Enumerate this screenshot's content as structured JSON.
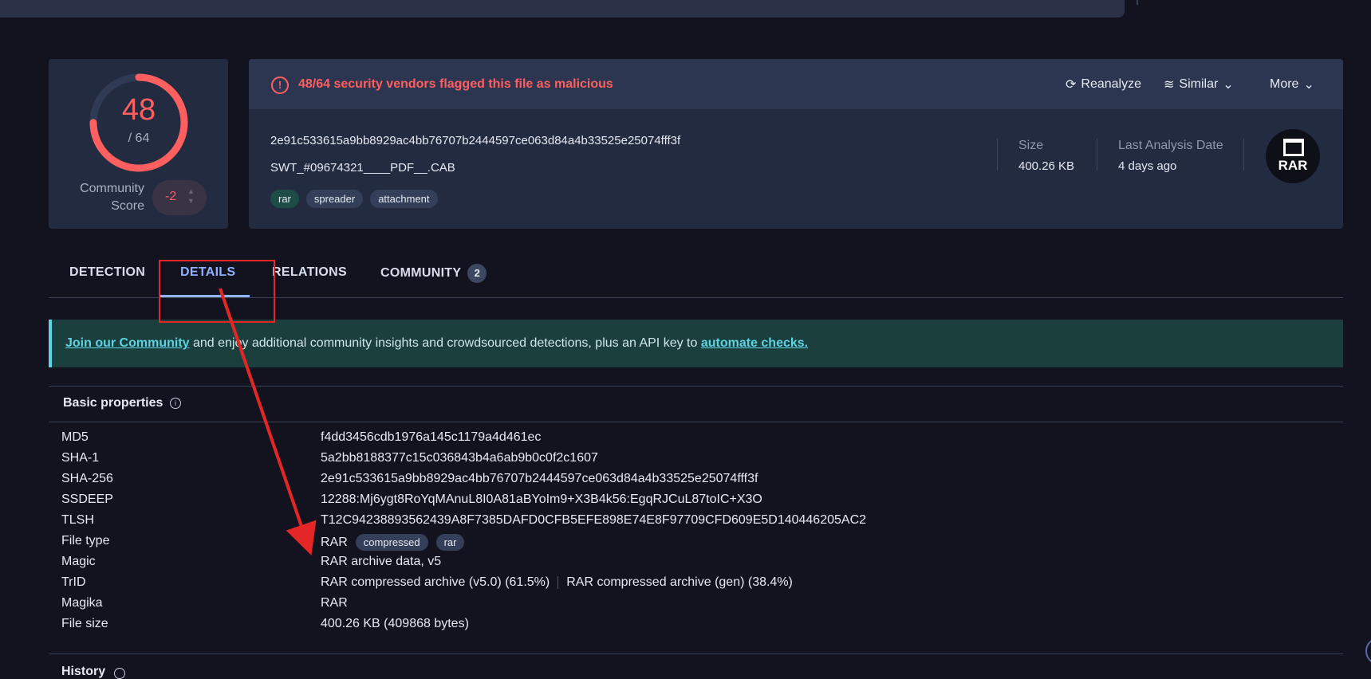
{
  "score": {
    "detections": "48",
    "total": "/ 64",
    "community_label": "Community Score",
    "community_value": "-2"
  },
  "header": {
    "alert": "48/64 security vendors flagged this file as malicious",
    "reanalyze": "Reanalyze",
    "similar": "Similar",
    "more": "More"
  },
  "file": {
    "hash": "2e91c533615a9bb8929ac4bb76707b2444597ce063d84a4b33525e25074fff3f",
    "name": "SWT_#09674321____PDF__.CAB",
    "tags": [
      "rar",
      "spreader",
      "attachment"
    ],
    "size_label": "Size",
    "size_value": "400.26 KB",
    "date_label": "Last Analysis Date",
    "date_value": "4 days ago",
    "type_badge": "RAR"
  },
  "tabs": {
    "detection": "DETECTION",
    "details": "DETAILS",
    "relations": "RELATIONS",
    "community": "COMMUNITY",
    "community_count": "2"
  },
  "banner": {
    "link1": "Join our Community",
    "text": " and enjoy additional community insights and crowdsourced detections, plus an API key to ",
    "link2": "automate checks."
  },
  "basic": {
    "title": "Basic properties",
    "md5_key": "MD5",
    "md5": "f4dd3456cdb1976a145c1179a4d461ec",
    "sha1_key": "SHA-1",
    "sha1": "5a2bb8188377c15c036843b4a6ab9b0c0f2c1607",
    "sha256_key": "SHA-256",
    "sha256": "2e91c533615a9bb8929ac4bb76707b2444597ce063d84a4b33525e25074fff3f",
    "ssdeep_key": "SSDEEP",
    "ssdeep": "12288:Mj6ygt8RoYqMAnuL8I0A81aBYoIm9+X3B4k56:EgqRJCuL87toIC+X3O",
    "tlsh_key": "TLSH",
    "tlsh": "T12C94238893562439A8F7385DAFD0CFB5EFE898E74E8F97709CFD609E5D140446205AC2",
    "filetype_key": "File type",
    "filetype": "RAR",
    "filetype_tags": [
      "compressed",
      "rar"
    ],
    "magic_key": "Magic",
    "magic": "RAR archive data, v5",
    "trid_key": "TrID",
    "trid1": "RAR compressed archive (v5.0) (61.5%)",
    "trid2": "RAR compressed archive (gen) (38.4%)",
    "magika_key": "Magika",
    "magika": "RAR",
    "filesize_key": "File size",
    "filesize": "400.26 KB (409868 bytes)"
  },
  "history": {
    "title": "History"
  }
}
